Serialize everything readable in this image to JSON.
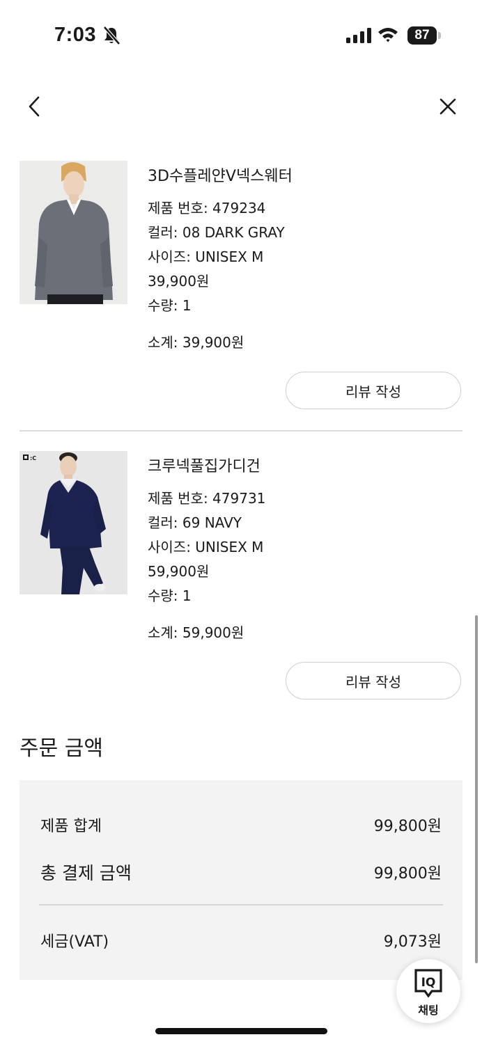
{
  "status_bar": {
    "time": "7:03",
    "battery": "87"
  },
  "nav": {
    "back_icon": "chevron-left-icon",
    "close_icon": "close-icon"
  },
  "products": [
    {
      "name": "3D수플레얀V넥스웨터",
      "product_number": "제품 번호: 479234",
      "color": "컬러: 08 DARK GRAY",
      "size": "사이즈: UNISEX M",
      "price": "39,900원",
      "quantity": "수량: 1",
      "subtotal": "소계: 39,900원",
      "review_button": "리뷰 작성",
      "image": "gray-v-neck-sweater-photo",
      "garment_color": "#6b7078"
    },
    {
      "name": "크루넥풀집가디건",
      "product_number": "제품 번호: 479731",
      "color": "컬러: 69 NAVY",
      "size": "사이즈: UNISEX M",
      "price": "59,900원",
      "quantity": "수량: 1",
      "subtotal": "소계: 59,900원",
      "review_button": "리뷰 작성",
      "image": "navy-cardigan-photo",
      "image_badge": "U:C",
      "garment_color": "#1c2350"
    }
  ],
  "order_summary": {
    "title": "주문 금액",
    "product_total_label": "제품 합계",
    "product_total_value": "99,800원",
    "payment_total_label": "총 결제 금액",
    "payment_total_value": "99,800원",
    "vat_label": "세금(VAT)",
    "vat_value": "9,073원"
  },
  "chat": {
    "logo_text": "IQ",
    "label": "채팅"
  }
}
